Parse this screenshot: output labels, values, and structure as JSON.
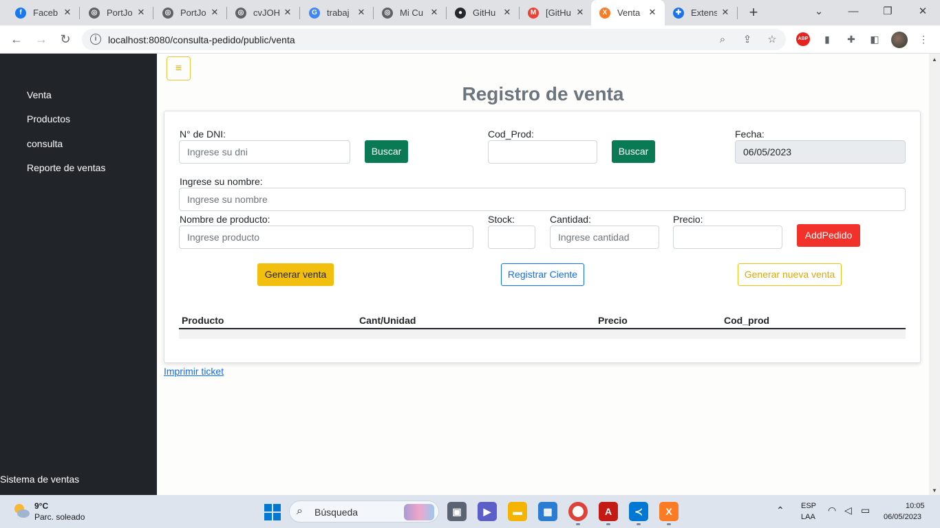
{
  "browser": {
    "tabs": [
      {
        "title": "Faceb",
        "favicon_color": "#1877f2",
        "favicon_glyph": "f"
      },
      {
        "title": "PortJo",
        "favicon_color": "#5f6368",
        "favicon_glyph": "◎"
      },
      {
        "title": "PortJo",
        "favicon_color": "#5f6368",
        "favicon_glyph": "◎"
      },
      {
        "title": "cvJOH",
        "favicon_color": "#5f6368",
        "favicon_glyph": "◎"
      },
      {
        "title": "trabaj",
        "favicon_color": "#4285f4",
        "favicon_glyph": "G"
      },
      {
        "title": "Mi Cu",
        "favicon_color": "#5f6368",
        "favicon_glyph": "◎"
      },
      {
        "title": "GitHu",
        "favicon_color": "#24292f",
        "favicon_glyph": "●"
      },
      {
        "title": "[GitHu",
        "favicon_color": "#ea4335",
        "favicon_glyph": "M"
      },
      {
        "title": "Venta",
        "favicon_color": "#fb7a24",
        "favicon_glyph": "X"
      },
      {
        "title": "Extens",
        "favicon_color": "#1a73e8",
        "favicon_glyph": "✚"
      }
    ],
    "active_tab_index": 8,
    "url": "localhost:8080/consulta-pedido/public/venta"
  },
  "sidebar": {
    "items": [
      {
        "label": "Venta"
      },
      {
        "label": "Productos"
      },
      {
        "label": "consulta"
      },
      {
        "label": "Reporte de ventas"
      }
    ],
    "footer": "Sistema de ventas"
  },
  "page": {
    "toggler_glyph": "≡",
    "title": "Registro de venta",
    "form": {
      "dni_label": "N° de DNI:",
      "dni_placeholder": "Ingrese su dni",
      "dni_search_button": "Buscar",
      "codprod_label": "Cod_Prod:",
      "codprod_value": "",
      "codprod_search_button": "Buscar",
      "fecha_label": "Fecha:",
      "fecha_value": "06/05/2023",
      "nombre_label": "Ingrese su nombre:",
      "nombre_placeholder": "Ingrese su nombre",
      "producto_label": "Nombre de producto:",
      "producto_placeholder": "Ingrese producto",
      "stock_label": "Stock:",
      "stock_value": "",
      "cantidad_label": "Cantidad:",
      "cantidad_placeholder": "Ingrese cantidad",
      "precio_label": "Precio:",
      "precio_value": "",
      "add_button": "AddPedido",
      "generar_venta_button": "Generar venta",
      "registrar_cliente_button": "Registrar Ciente",
      "nueva_venta_button": "Generar nueva venta"
    },
    "table": {
      "headers": [
        "Producto",
        "Cant/Unidad",
        "Precio",
        "Cod_prod"
      ],
      "rows": []
    },
    "ticket_link": "Imprimir ticket"
  },
  "taskbar": {
    "weather_temp": "9°C",
    "weather_desc": "Parc. soleado",
    "search_placeholder": "Búsqueda",
    "lang_top": "ESP",
    "lang_bottom": "LAA",
    "time": "10:05",
    "date": "06/05/2023"
  }
}
